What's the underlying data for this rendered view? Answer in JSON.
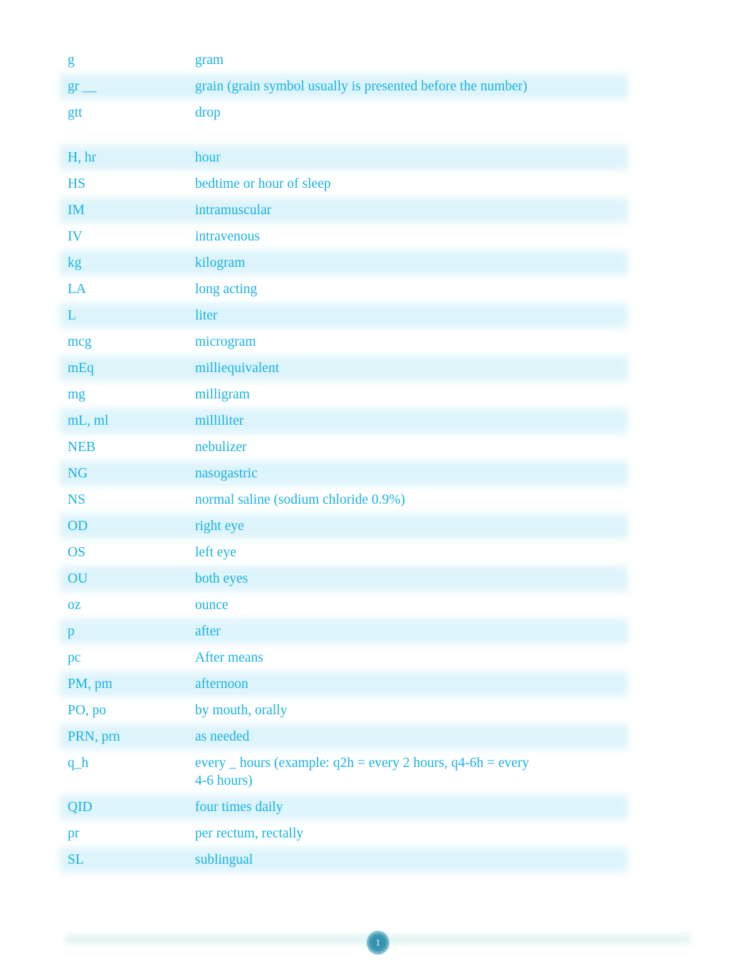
{
  "document": {
    "rows_block_1": [
      {
        "abbr": "g",
        "meaning": "gram",
        "shaded": false
      },
      {
        "abbr": "gr __",
        "meaning": "grain (grain symbol usually is presented before the number)",
        "shaded": true
      },
      {
        "abbr": "gtt",
        "meaning": "drop",
        "shaded": false
      }
    ],
    "rows_block_2": [
      {
        "abbr": "H, hr",
        "meaning": "hour",
        "shaded": true
      },
      {
        "abbr": "HS",
        "meaning": "bedtime or hour of sleep",
        "shaded": false
      },
      {
        "abbr": "IM",
        "meaning": "intramuscular",
        "shaded": true
      },
      {
        "abbr": "IV",
        "meaning": "intravenous",
        "shaded": false
      },
      {
        "abbr": "kg",
        "meaning": "kilogram",
        "shaded": true
      },
      {
        "abbr": "LA",
        "meaning": "long acting",
        "shaded": false
      },
      {
        "abbr": "L",
        "meaning": "liter",
        "shaded": true
      },
      {
        "abbr": "mcg",
        "meaning": "microgram",
        "shaded": false
      },
      {
        "abbr": "mEq",
        "meaning": "milliequivalent",
        "shaded": true
      },
      {
        "abbr": "mg",
        "meaning": "milligram",
        "shaded": false
      },
      {
        "abbr": "mL, ml",
        "meaning": "milliliter",
        "shaded": true
      },
      {
        "abbr": "NEB",
        "meaning": "nebulizer",
        "shaded": false
      },
      {
        "abbr": "NG",
        "meaning": "nasogastric",
        "shaded": true
      },
      {
        "abbr": "NS",
        "meaning": "normal saline (sodium chloride 0.9%)",
        "shaded": false
      },
      {
        "abbr": "OD",
        "meaning": "right eye",
        "shaded": true
      },
      {
        "abbr": "OS",
        "meaning": "left eye",
        "shaded": false
      },
      {
        "abbr": "OU",
        "meaning": "both eyes",
        "shaded": true
      },
      {
        "abbr": "oz",
        "meaning": "ounce",
        "shaded": false
      },
      {
        "abbr": "p",
        "meaning": "after",
        "shaded": true
      },
      {
        "abbr": "pc",
        "meaning": "After means",
        "shaded": false
      },
      {
        "abbr": "PM, pm",
        "meaning": "afternoon",
        "shaded": true
      },
      {
        "abbr": "PO, po",
        "meaning": "by mouth, orally",
        "shaded": false
      },
      {
        "abbr": "PRN, prn",
        "meaning": "as needed",
        "shaded": true
      },
      {
        "abbr": "q_h",
        "meaning": "every _ hours (example: q2h = every 2 hours, q4-6h = every 4-6 hours)",
        "shaded": false
      },
      {
        "abbr": "QID",
        "meaning": "four times daily",
        "shaded": true
      },
      {
        "abbr": "pr",
        "meaning": "per rectum, rectally",
        "shaded": false
      },
      {
        "abbr": "SL",
        "meaning": "sublingual",
        "shaded": true
      }
    ]
  },
  "footer": {
    "page_number": "1"
  },
  "colors": {
    "text": "#19b1e3",
    "band": "#ddf4fb",
    "page_badge": "#2f8dab"
  }
}
